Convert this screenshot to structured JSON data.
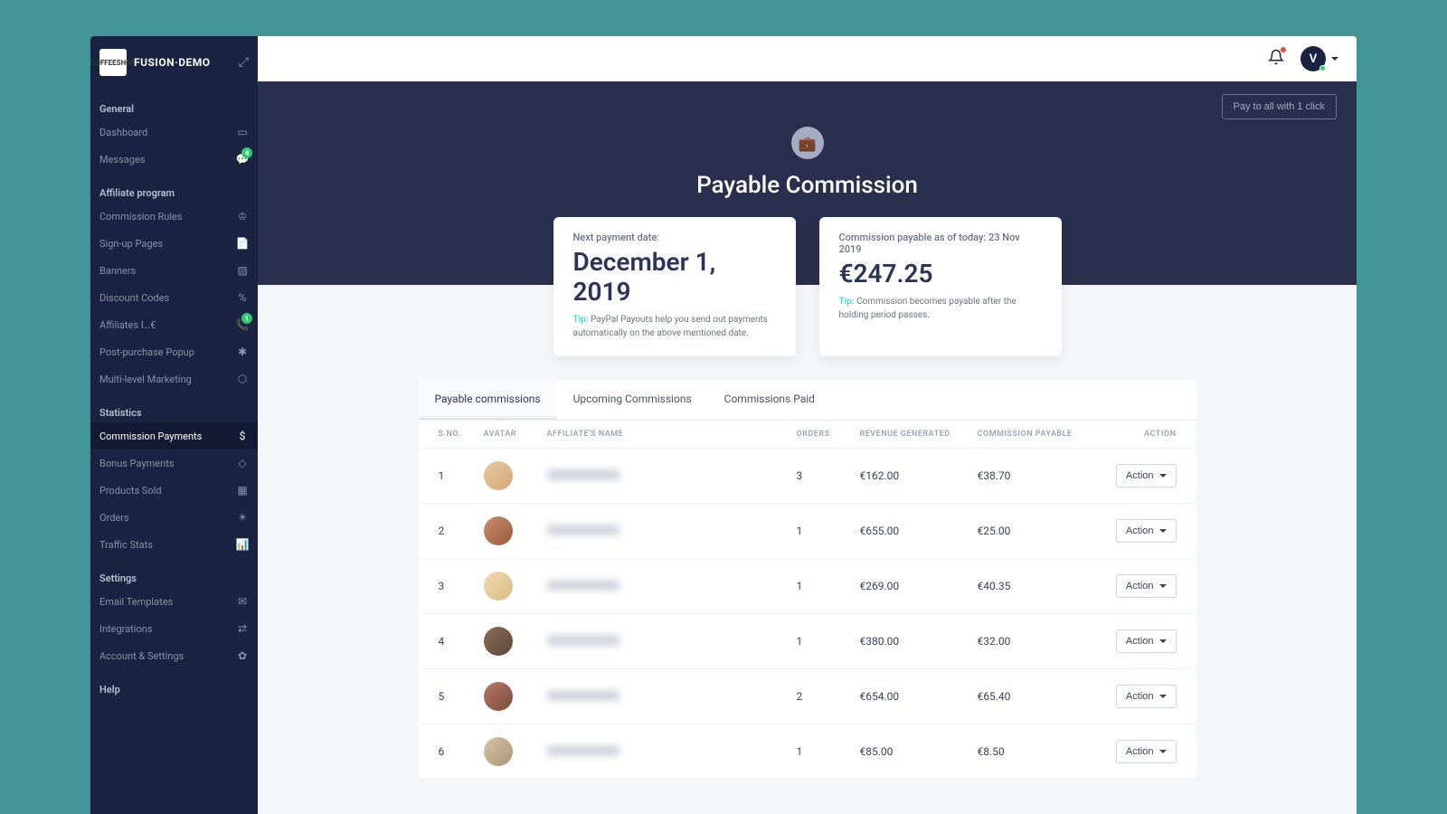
{
  "app": {
    "name": "FUSION·DEMO",
    "logo_text": "COFFEESHOP"
  },
  "topbar": {
    "avatar_initial": "V"
  },
  "sidebar": {
    "sections": [
      {
        "title": "General",
        "items": [
          {
            "label": "Dashboard",
            "icon": "▭"
          },
          {
            "label": "Messages",
            "icon": "💬",
            "badge": "4"
          }
        ]
      },
      {
        "title": "Affiliate program",
        "items": [
          {
            "label": "Commission Rules",
            "icon": "♔"
          },
          {
            "label": "Sign-up Pages",
            "icon": "📄"
          },
          {
            "label": "Banners",
            "icon": "▨"
          },
          {
            "label": "Discount Codes",
            "icon": "%"
          },
          {
            "label": "Affiliates I…€",
            "icon": "📞",
            "badge": "1"
          },
          {
            "label": "Post-purchase Popup",
            "icon": "✱"
          },
          {
            "label": "Multi-level Marketing",
            "icon": "⬡"
          }
        ]
      },
      {
        "title": "Statistics",
        "items": [
          {
            "label": "Commission Payments",
            "icon": "$",
            "active": true
          },
          {
            "label": "Bonus Payments",
            "icon": "◇"
          },
          {
            "label": "Products Sold",
            "icon": "▦"
          },
          {
            "label": "Orders",
            "icon": "☀"
          },
          {
            "label": "Traffic Stats",
            "icon": "📊"
          }
        ]
      },
      {
        "title": "Settings",
        "items": [
          {
            "label": "Email Templates",
            "icon": "✉"
          },
          {
            "label": "Integrations",
            "icon": "⇄"
          },
          {
            "label": "Account & Settings",
            "icon": "✿"
          }
        ]
      },
      {
        "title": "Help",
        "items": []
      }
    ]
  },
  "hero": {
    "title": "Payable Commission",
    "pay_all_label": "Pay to all with 1 click"
  },
  "cards": {
    "next_payment": {
      "label": "Next payment date:",
      "value": "December 1, 2019",
      "tip_label": "Tip:",
      "tip": "PayPal Payouts help you send out payments automatically on the above mentioned date."
    },
    "payable": {
      "label": "Commission payable as of today: 23 Nov 2019",
      "value": "€247.25",
      "tip_label": "Tip:",
      "tip": "Commission becomes payable after the holding period passes."
    }
  },
  "tabs": {
    "payable": "Payable commissions",
    "upcoming": "Upcoming Commissions",
    "paid": "Commissions Paid"
  },
  "table": {
    "headers": {
      "sno": "S.NO.",
      "avatar": "AVATAR",
      "name": "AFFILIATE'S NAME",
      "orders": "ORDERS",
      "revenue": "REVENUE GENERATED",
      "commission": "COMMISSION PAYABLE",
      "action": "ACTION"
    },
    "action_label": "Action",
    "rows": [
      {
        "sno": "1",
        "orders": "3",
        "revenue": "€162.00",
        "commission": "€38.70"
      },
      {
        "sno": "2",
        "orders": "1",
        "revenue": "€655.00",
        "commission": "€25.00"
      },
      {
        "sno": "3",
        "orders": "1",
        "revenue": "€269.00",
        "commission": "€40.35"
      },
      {
        "sno": "4",
        "orders": "1",
        "revenue": "€380.00",
        "commission": "€32.00"
      },
      {
        "sno": "5",
        "orders": "2",
        "revenue": "€654.00",
        "commission": "€65.40"
      },
      {
        "sno": "6",
        "orders": "1",
        "revenue": "€85.00",
        "commission": "€8.50"
      }
    ]
  }
}
